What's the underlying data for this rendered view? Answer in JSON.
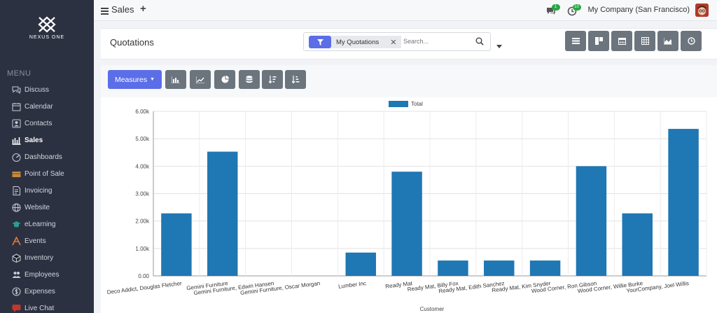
{
  "sidebar": {
    "logo_text": "NEXUS ONE",
    "menu_label": "MENU",
    "items": [
      {
        "label": "Discuss",
        "icon": "chat-icon"
      },
      {
        "label": "Calendar",
        "icon": "calendar-icon"
      },
      {
        "label": "Contacts",
        "icon": "contacts-icon"
      },
      {
        "label": "Sales",
        "icon": "sales-icon",
        "active": true
      },
      {
        "label": "Dashboards",
        "icon": "dashboard-icon"
      },
      {
        "label": "Point of Sale",
        "icon": "pos-icon"
      },
      {
        "label": "Invoicing",
        "icon": "invoice-icon"
      },
      {
        "label": "Website",
        "icon": "globe-icon"
      },
      {
        "label": "eLearning",
        "icon": "elearning-icon"
      },
      {
        "label": "Events",
        "icon": "events-icon"
      },
      {
        "label": "Inventory",
        "icon": "inventory-icon"
      },
      {
        "label": "Employees",
        "icon": "employees-icon"
      },
      {
        "label": "Expenses",
        "icon": "expenses-icon"
      },
      {
        "label": "Live Chat",
        "icon": "livechat-icon"
      }
    ]
  },
  "topbar": {
    "app_title": "Sales",
    "plus": "+",
    "messages_count": "1",
    "activities_count": "10",
    "company": "My Company (San Francisco)"
  },
  "control_panel": {
    "title": "Quotations",
    "facet": "My Quotations",
    "search_placeholder": "Search..."
  },
  "buttons": {
    "measures_label": "Measures"
  },
  "chart_data": {
    "type": "bar",
    "categories": [
      "Deco Addict, Douglas Fletcher",
      "Gemini Furniture",
      "Gemini Furniture, Edwin Hansen",
      "Gemini Furniture, Oscar Morgan",
      "Lumber Inc",
      "Ready Mat",
      "Ready Mat, Billy Fox",
      "Ready Mat, Edith Sanchez",
      "Ready Mat, Kim Snyder",
      "Wood Corner, Ron Gibson",
      "Wood Corner, Willie Burke",
      "YourCompany, Joel Willis"
    ],
    "series": [
      {
        "name": "Total",
        "values": [
          2280,
          4530,
          0,
          0,
          850,
          3800,
          560,
          560,
          560,
          4000,
          2280,
          5360
        ]
      }
    ],
    "xlabel": "Customer",
    "ylabel": "",
    "ylim": [
      0,
      6000
    ],
    "yticks": [
      "0.00",
      "1.00k",
      "2.00k",
      "3.00k",
      "4.00k",
      "5.00k",
      "6.00k"
    ],
    "legend_position": "top",
    "grid": true,
    "color": "#1f77b4"
  }
}
